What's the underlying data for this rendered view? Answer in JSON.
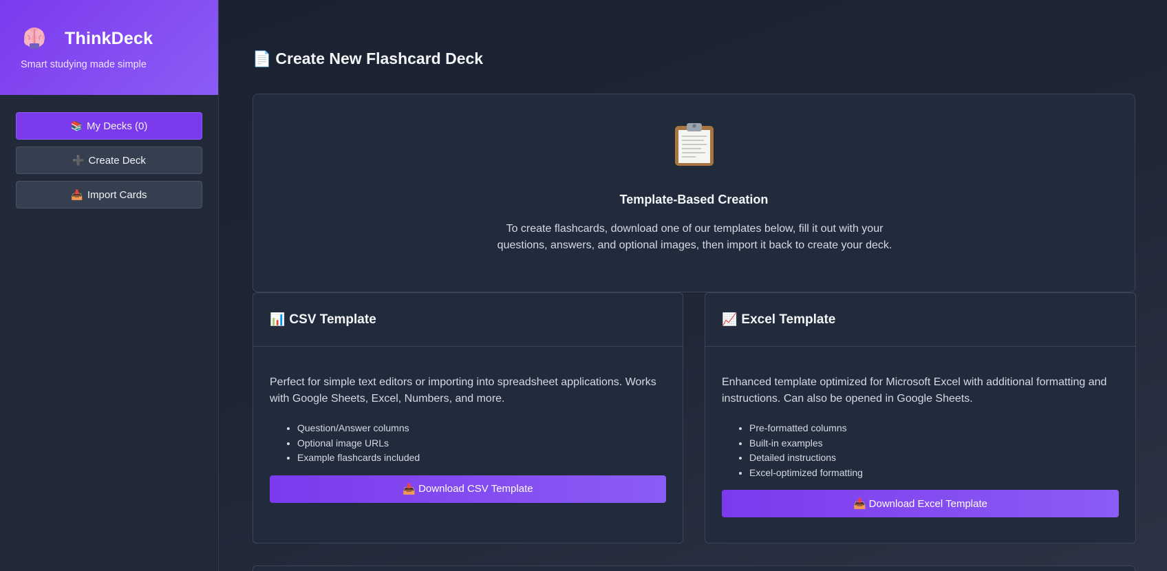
{
  "app": {
    "name": "ThinkDeck",
    "tagline": "Smart studying made simple",
    "logo_icon": "brain-icon"
  },
  "sidebar": {
    "items": [
      {
        "icon": "📚",
        "icon_name": "books-icon",
        "label": "My Decks (0)",
        "active": true
      },
      {
        "icon": "➕",
        "icon_name": "plus-icon",
        "label": "Create Deck",
        "active": false
      },
      {
        "icon": "📥",
        "icon_name": "inbox-tray-icon",
        "label": "Import Cards",
        "active": false
      }
    ]
  },
  "main": {
    "title_icon": "📄",
    "title": "Create New Flashcard Deck",
    "hero": {
      "icon_name": "clipboard-icon",
      "title": "Template-Based Creation",
      "description": "To create flashcards, download one of our templates below, fill it out with your questions, answers, and optional images, then import it back to create your deck."
    },
    "cards": {
      "csv": {
        "icon": "📊",
        "title": "CSV Template",
        "description": "Perfect for simple text editors or importing into spreadsheet applications. Works with Google Sheets, Excel, Numbers, and more.",
        "features": [
          "Question/Answer columns",
          "Optional image URLs",
          "Example flashcards included"
        ],
        "button_icon": "📥",
        "button_label": "Download CSV Template"
      },
      "excel": {
        "icon": "📈",
        "title": "Excel Template",
        "description": "Enhanced template optimized for Microsoft Excel with additional formatting and instructions. Can also be opened in Google Sheets.",
        "features": [
          "Pre-formatted columns",
          "Built-in examples",
          "Detailed instructions",
          "Excel-optimized formatting"
        ],
        "button_icon": "📥",
        "button_label": "Download Excel Template"
      }
    }
  },
  "colors": {
    "accent": "#7c3aed",
    "accent_light": "#8b5cf6",
    "background": "#1e2433",
    "card": "#222b3b"
  }
}
